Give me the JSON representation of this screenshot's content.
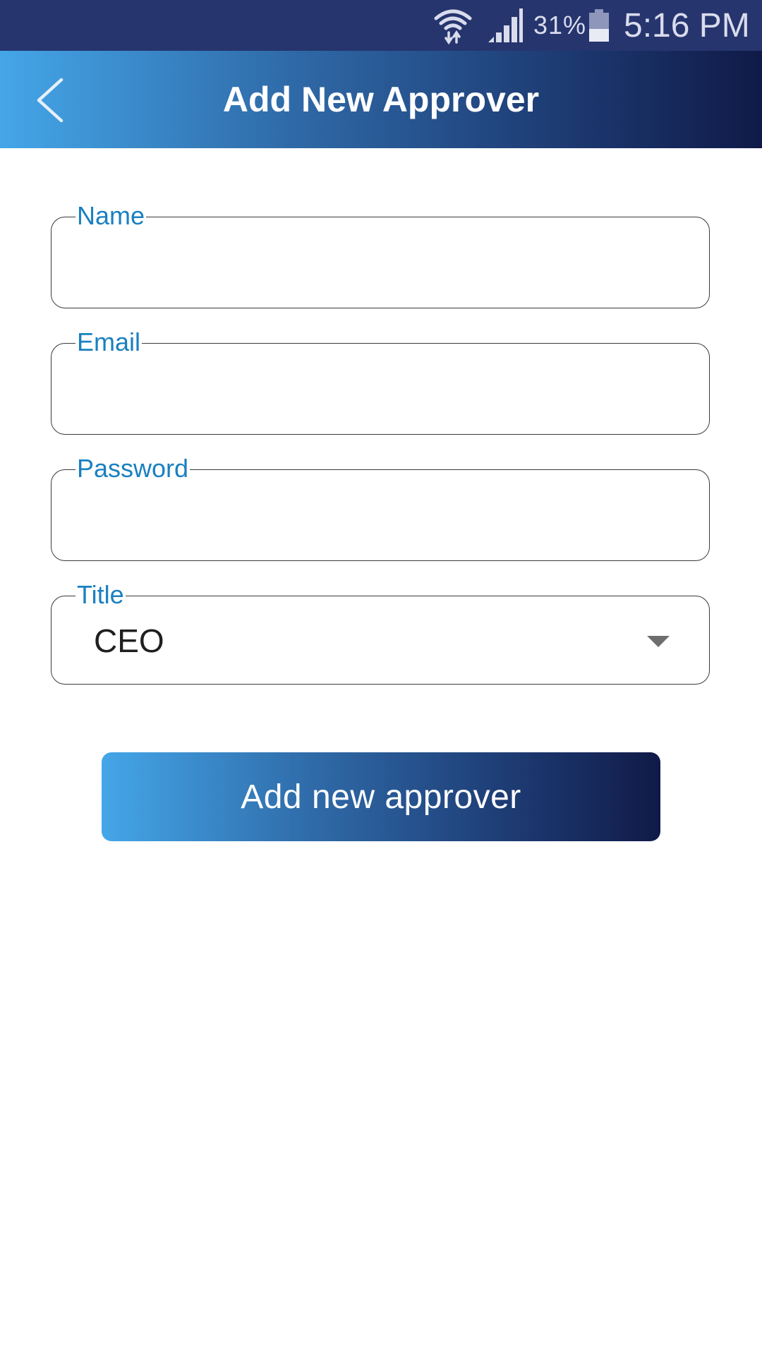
{
  "status_bar": {
    "battery_percent": "31%",
    "time": "5:16 PM",
    "icons": [
      "wifi-icon",
      "signal-icon",
      "battery-icon"
    ]
  },
  "header": {
    "title": "Add New Approver",
    "back_icon": "chevron-left-icon"
  },
  "form": {
    "name": {
      "label": "Name",
      "value": ""
    },
    "email": {
      "label": "Email",
      "value": ""
    },
    "password": {
      "label": "Password",
      "value": ""
    },
    "title": {
      "label": "Title",
      "selected": "CEO",
      "icon": "caret-down-icon"
    }
  },
  "submit": {
    "label": "Add new approver"
  },
  "colors": {
    "status_bar_bg": "#26356e",
    "gradient_start": "#44a6e8",
    "gradient_end": "#101a48",
    "label_blue": "#1a80c0"
  }
}
